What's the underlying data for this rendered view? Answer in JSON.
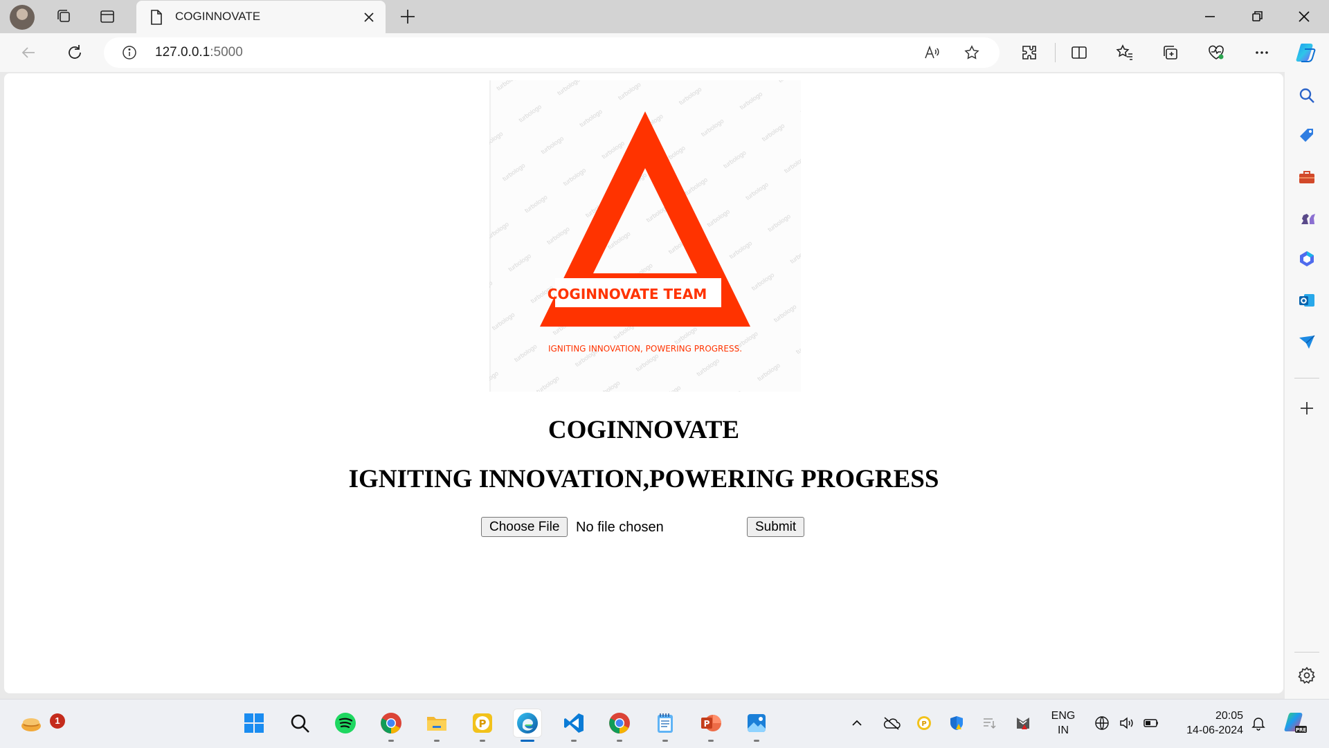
{
  "browser": {
    "tab_title": "COGINNOVATE",
    "url_host": "127.0.0.1",
    "url_port": ":5000"
  },
  "page": {
    "logo_team": "COGINNOVATE  TEAM",
    "logo_tagline": "IGNITING INNOVATION, POWERING PROGRESS.",
    "logo_watermark": "turbologo",
    "heading": "COGINNOVATE",
    "subheading": "IGNITING INNOVATION,POWERING PROGRESS",
    "file_button": "Choose File",
    "file_status": "No file chosen",
    "submit_button": "Submit"
  },
  "taskbar": {
    "notification_count": "1",
    "lang_line1": "ENG",
    "lang_line2": "IN",
    "time": "20:05",
    "date": "14-06-2024"
  },
  "colors": {
    "brand_red": "#ff3300",
    "accent_blue": "#0067c0"
  }
}
